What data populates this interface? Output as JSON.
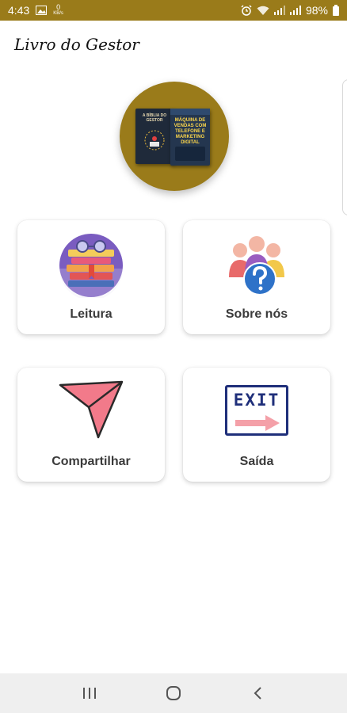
{
  "status_bar": {
    "time": "4:43",
    "data_rate_value": "0",
    "data_rate_unit": "KB/s",
    "battery": "98%",
    "icons": [
      "gallery-icon",
      "alarm-icon",
      "wifi-icon",
      "signal-icon",
      "signal-icon",
      "battery-icon"
    ]
  },
  "app": {
    "title": "Livro do Gestor",
    "accent_color": "#9a7b1a",
    "logo_books": [
      {
        "title": "A BÍBLIA DO GESTOR"
      },
      {
        "title": "MÁQUINA DE VENDAS COM TELEFONE E MARKETING DIGITAL"
      }
    ]
  },
  "menu": {
    "items": [
      {
        "label": "Leitura",
        "icon": "books-icon"
      },
      {
        "label": "Sobre nós",
        "icon": "people-question-icon"
      },
      {
        "label": "Compartilhar",
        "icon": "paper-plane-icon"
      },
      {
        "label": "Saída",
        "icon": "exit-sign-icon",
        "icon_text": "EXIT"
      }
    ]
  },
  "nav": {
    "recent": "recent-apps-icon",
    "home": "home-icon",
    "back": "back-icon"
  }
}
